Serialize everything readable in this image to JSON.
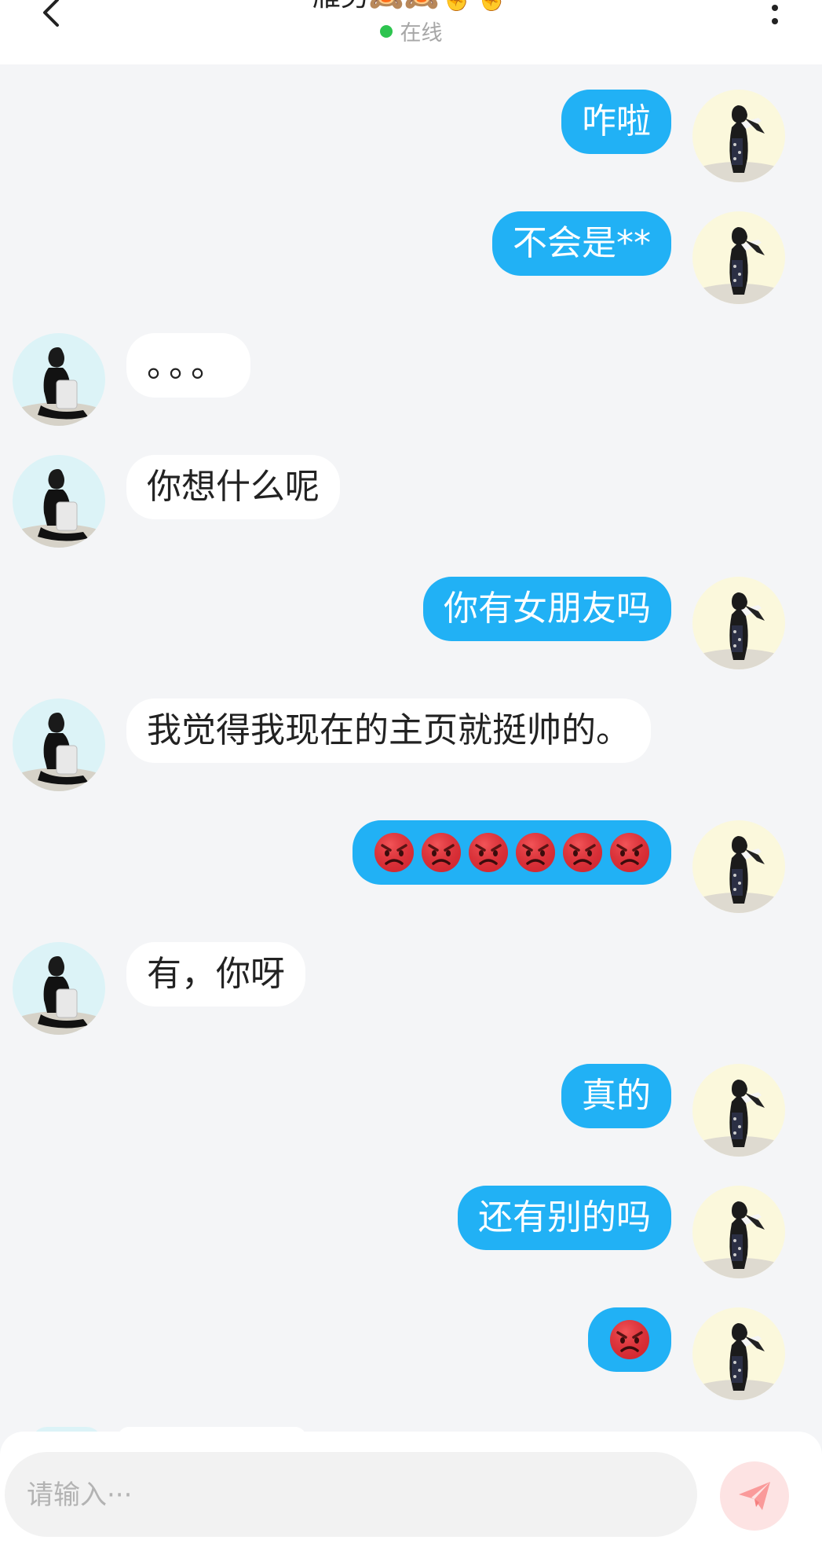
{
  "header": {
    "title": "雁男🙈🙈🤞🤞",
    "status": "在线",
    "status_color": "#2dc44f"
  },
  "messages": [
    {
      "side": "me",
      "text": "咋啦"
    },
    {
      "side": "me",
      "text": "不会是**"
    },
    {
      "side": "other",
      "text": "。。。"
    },
    {
      "side": "other",
      "text": "你想什么呢"
    },
    {
      "side": "me",
      "text": "你有女朋友吗"
    },
    {
      "side": "other",
      "text": "我觉得我现在的主页就挺帅的。"
    },
    {
      "side": "me",
      "emoji": "angry-face",
      "count": 6
    },
    {
      "side": "other",
      "text": "有，你呀"
    },
    {
      "side": "me",
      "text": "真的"
    },
    {
      "side": "me",
      "text": "还有别的吗"
    },
    {
      "side": "me",
      "emoji": "angry-face",
      "count": 1
    }
  ],
  "input": {
    "placeholder": "请输入···"
  },
  "icons": {
    "back": "chevron-left-icon",
    "more": "more-vertical-icon",
    "send": "paper-plane-icon",
    "avatar_me": "girl-in-kimono-avatar",
    "avatar_other": "boy-sitting-avatar"
  },
  "colors": {
    "bubble_me": "#21b1f5",
    "bubble_other": "#ffffff",
    "send_button_bg": "#fde3e3",
    "send_icon": "#fa9a9a"
  }
}
